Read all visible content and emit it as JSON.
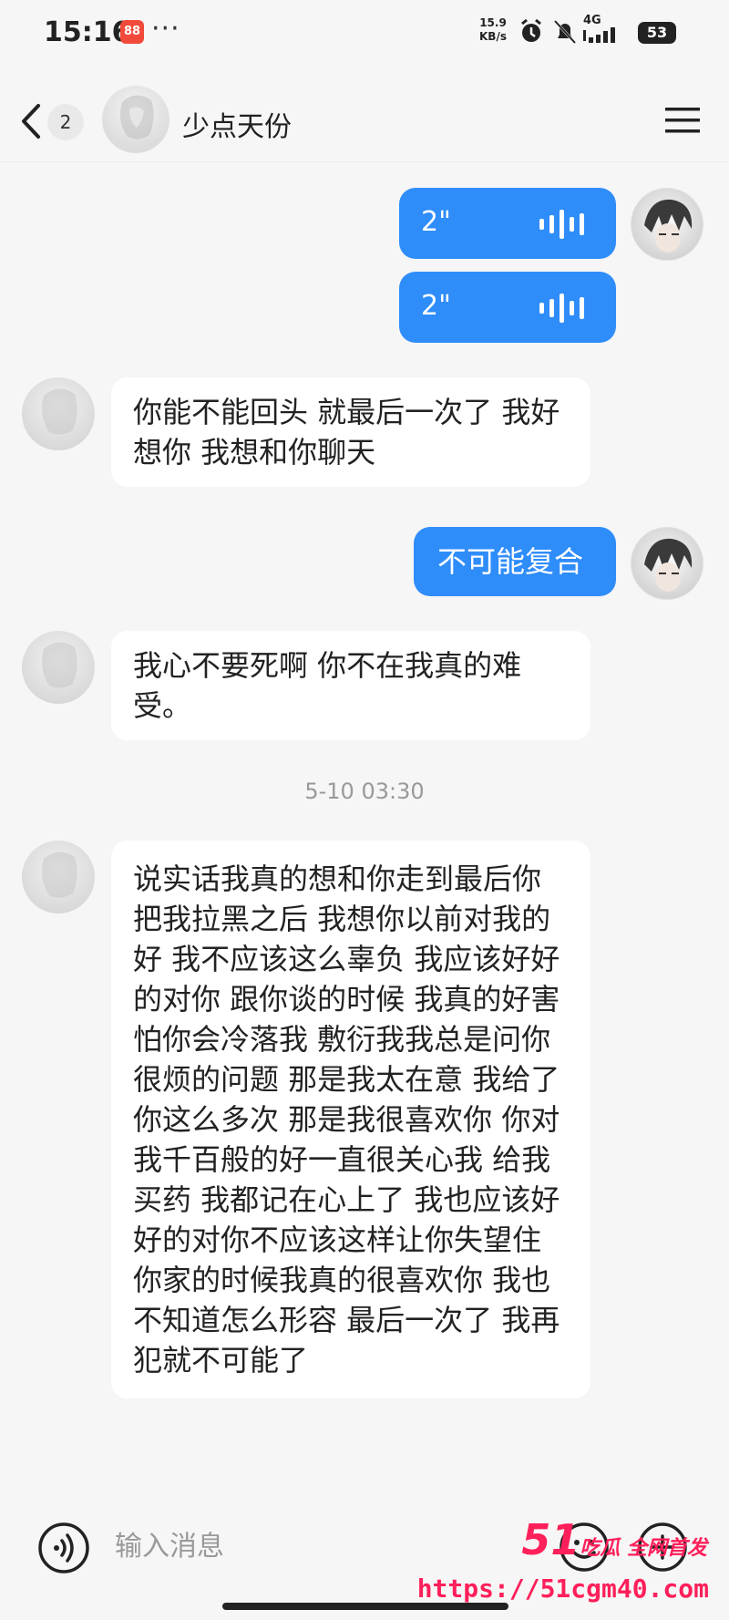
{
  "status_bar": {
    "time": "15:16",
    "app_badge": "88",
    "dots": "···",
    "net_speed_value": "15.9",
    "net_speed_unit": "KB/s",
    "signal": "4G",
    "battery": "53"
  },
  "header": {
    "unread_count": "2",
    "contact_name": "少点天份"
  },
  "messages": {
    "voice1_duration": "2\"",
    "voice2_duration": "2\"",
    "msg1": "你能不能回头 就最后一次了 我好想你 我想和你聊天",
    "msg2": "不可能复合",
    "msg3": "我心不要死啊 你不在我真的难受。",
    "timestamp": "5-10 03:30",
    "msg4": "说实话我真的想和你走到最后你把我拉黑之后 我想你以前对我的好 我不应该这么辜负 我应该好好的对你 跟你谈的时候 我真的好害怕你会冷落我 敷衍我我总是问你很烦的问题 那是我太在意 我给了你这么多次 那是我很喜欢你 你对我千百般的好一直很关心我 给我买药 我都记在心上了 我也应该好好的对你不应该这样让你失望住你家的时候我真的很喜欢你 我也不知道怎么形容 最后一次了 我再犯就不可能了"
  },
  "input_bar": {
    "placeholder": "输入消息"
  },
  "watermark": {
    "line1_main": "51",
    "line1_sub": "吃瓜 全网首发",
    "line2": "https://51cgm40.com"
  },
  "colors": {
    "accent": "#2f8dfa",
    "watermark": "#ff1f5a"
  }
}
